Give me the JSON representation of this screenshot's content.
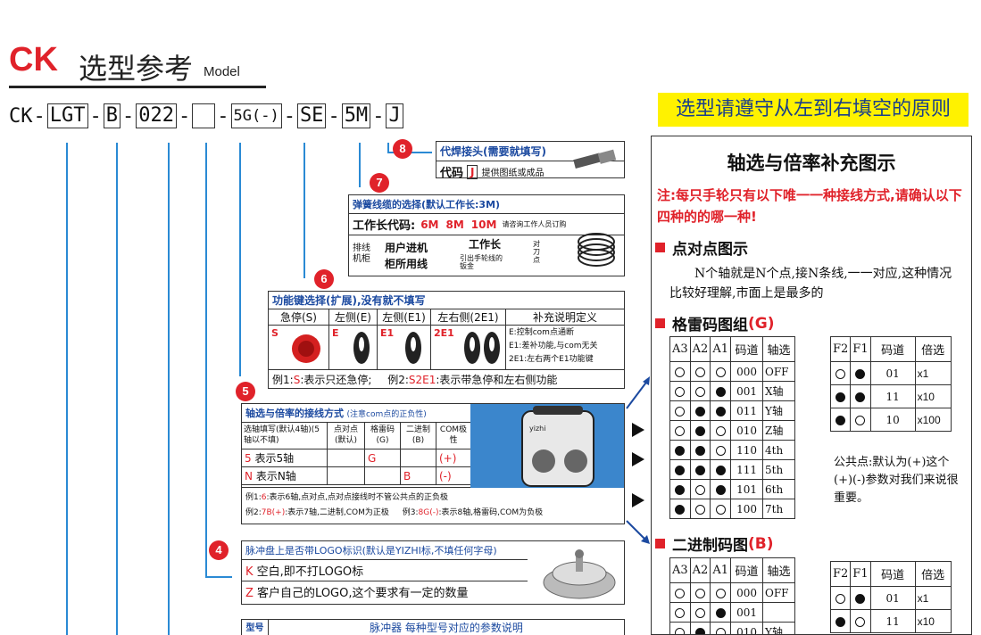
{
  "header": {
    "brand": "CK",
    "title": "选型参考",
    "title_en": "Model"
  },
  "code": {
    "prefix": "CK",
    "parts": [
      "LGT",
      "B",
      "022",
      "",
      "5G(-)",
      "SE",
      "5M",
      "J"
    ]
  },
  "banner": "选型请遵守从左到右填空的原则",
  "step8": {
    "num": "8",
    "title": "代焊接头(需要就填写)",
    "code_label": "代码",
    "code": "J",
    "desc": "提供图纸或成品"
  },
  "step7": {
    "num": "7",
    "title": "弹簧线缆的选择(默认工作长:3M)",
    "len_label": "工作长代码:",
    "lens": [
      "6M",
      "8M",
      "10M"
    ],
    "len_note": "请咨询工作人员订购",
    "side_label": "排线机柜",
    "row1": "用户进机",
    "row2": "柜所用线",
    "work_len": "工作长",
    "lead_label": "引出手轮线的钣金",
    "tool_label": "对刀点"
  },
  "step6": {
    "num": "6",
    "title": "功能键选择(扩展),没有就不填写",
    "cols": [
      "急停(S)",
      "左侧(E)",
      "左侧(E1)",
      "左右侧(2E1)",
      "补充说明定义"
    ],
    "codes": [
      "S",
      "E",
      "E1",
      "2E1"
    ],
    "notes": [
      "E:控制com点通断",
      "E1:差补功能,与com无关",
      "2E1:左右两个E1功能键"
    ],
    "ex1_pre": "例1:",
    "ex1_code": "S",
    "ex1_text": ":表示只还急停;",
    "ex2_pre": "例2:",
    "ex2_code": "S2E1",
    "ex2_text": ":表示带急停和左右侧功能"
  },
  "step5": {
    "num": "5",
    "title": "轴选与倍率的接线方式",
    "title_note": "(注意com点的正负性)",
    "headers": [
      "选轴填写(默认4轴)(5轴以不填)",
      "点对点(默认)",
      "格雷码(G)",
      "二进制(B)",
      "COM极性"
    ],
    "rows": [
      {
        "code": "5",
        "text": "表示5轴",
        "g": "G",
        "b": "",
        "com": "(+)"
      },
      {
        "code": "N",
        "text": "表示N轴",
        "g": "",
        "b": "B",
        "com": "(-)"
      }
    ],
    "ex1_pre": "例1:",
    "ex1_code": "6",
    "ex1_text": ":表示6轴,点对点,点对点接线时不管公共点的正负极",
    "ex2_pre": "例2:",
    "ex2_code": "7B(+)",
    "ex2_text": ":表示7轴,二进制,COM为正极",
    "ex3_pre": "例3:",
    "ex3_code": "8G(-)",
    "ex3_text": ":表示8轴,格雷码,COM为负极",
    "device_brand": "yizhi"
  },
  "step4": {
    "num": "4",
    "title": "脉冲盘上是否带LOGO标识(默认是YIZHI标,不填任何字母)",
    "rows": [
      {
        "code": "K",
        "text": "空白,即不打LOGO标"
      },
      {
        "code": "Z",
        "text": "客户自己的LOGO,这个要求有一定的数量"
      }
    ]
  },
  "step3": {
    "col": "型号",
    "title": "脉冲器 每种型号对应的参数说明"
  },
  "side": {
    "title": "轴选与倍率补充图示",
    "note": "注:每只手轮只有以下唯一一种接线方式,请确认以下四种的的哪一种!",
    "p2p_head": "点对点图示",
    "p2p_text": "N个轴就是N个点,接N条线,一一对应,这种情况比较好理解,市面上是最多的",
    "gray_head": "格雷码图组",
    "gray_tag": "(G)",
    "bin_head": "二进制码图",
    "bin_tag": "(B)",
    "axis_headers": [
      "A3",
      "A2",
      "A1",
      "码道",
      "轴选"
    ],
    "gray_rows": [
      {
        "d": [
          0,
          0,
          0
        ],
        "code": "000",
        "axis": "OFF"
      },
      {
        "d": [
          0,
          0,
          1
        ],
        "code": "001",
        "axis": "X轴"
      },
      {
        "d": [
          0,
          1,
          1
        ],
        "code": "011",
        "axis": "Y轴"
      },
      {
        "d": [
          0,
          1,
          0
        ],
        "code": "010",
        "axis": "Z轴"
      },
      {
        "d": [
          1,
          1,
          0
        ],
        "code": "110",
        "axis": "4th"
      },
      {
        "d": [
          1,
          1,
          1
        ],
        "code": "111",
        "axis": "5th"
      },
      {
        "d": [
          1,
          0,
          1
        ],
        "code": "101",
        "axis": "6th"
      },
      {
        "d": [
          1,
          0,
          0
        ],
        "code": "100",
        "axis": "7th"
      }
    ],
    "rate_headers": [
      "F2",
      "F1",
      "码道",
      "倍选"
    ],
    "gray_rate_rows": [
      {
        "d": [
          0,
          1
        ],
        "code": "01",
        "rate": "x1"
      },
      {
        "d": [
          1,
          1
        ],
        "code": "11",
        "rate": "x10"
      },
      {
        "d": [
          1,
          0
        ],
        "code": "10",
        "rate": "x100"
      }
    ],
    "com_note": "公共点:默认为(+)这个(+)(-)参数对我们来说很重要。",
    "bin_rows": [
      {
        "d": [
          0,
          0,
          0
        ],
        "code": "000",
        "axis": "OFF"
      },
      {
        "d": [
          0,
          0,
          1
        ],
        "code": "001",
        "axis": ""
      },
      {
        "d": [
          0,
          1,
          0
        ],
        "code": "010",
        "axis": "Y轴"
      }
    ],
    "bin_rate_rows": [
      {
        "d": [
          0,
          1
        ],
        "code": "01",
        "rate": "x1"
      },
      {
        "d": [
          1,
          0
        ],
        "code": "11",
        "rate": "x10"
      }
    ]
  }
}
